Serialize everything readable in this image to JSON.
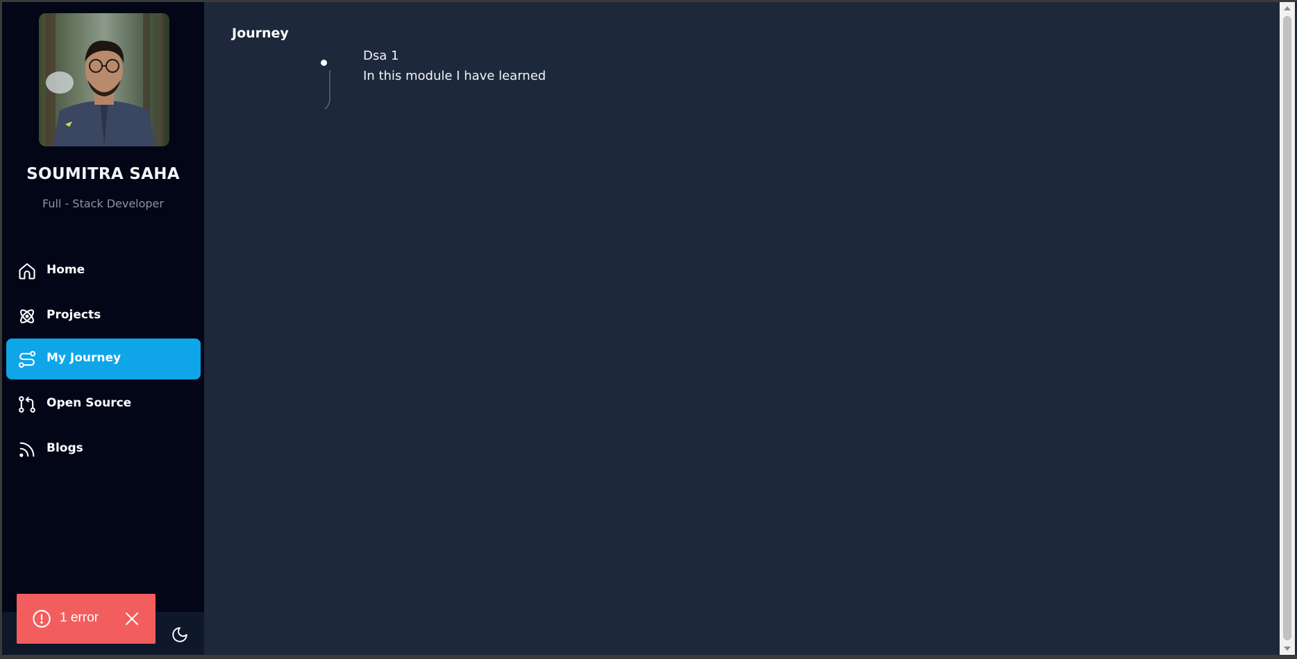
{
  "profile": {
    "name": "SOUMITRA SAHA",
    "role": "Full - Stack Developer"
  },
  "nav": {
    "items": [
      {
        "label": "Home",
        "icon": "home-icon"
      },
      {
        "label": "Projects",
        "icon": "atom-icon"
      },
      {
        "label": "My Journey",
        "icon": "route-icon",
        "active": true
      },
      {
        "label": "Open Source",
        "icon": "git-pull-request-icon"
      },
      {
        "label": "Blogs",
        "icon": "rss-icon"
      }
    ]
  },
  "main": {
    "title": "Journey",
    "timeline": [
      {
        "title": "Dsa 1",
        "description": "In this module I have learned"
      }
    ]
  },
  "toast": {
    "text": "1 error",
    "color": "#f25d5d"
  },
  "colors": {
    "accent": "#0ea5e9",
    "sidebar_bg": "#020617",
    "main_bg": "#1e283b"
  }
}
